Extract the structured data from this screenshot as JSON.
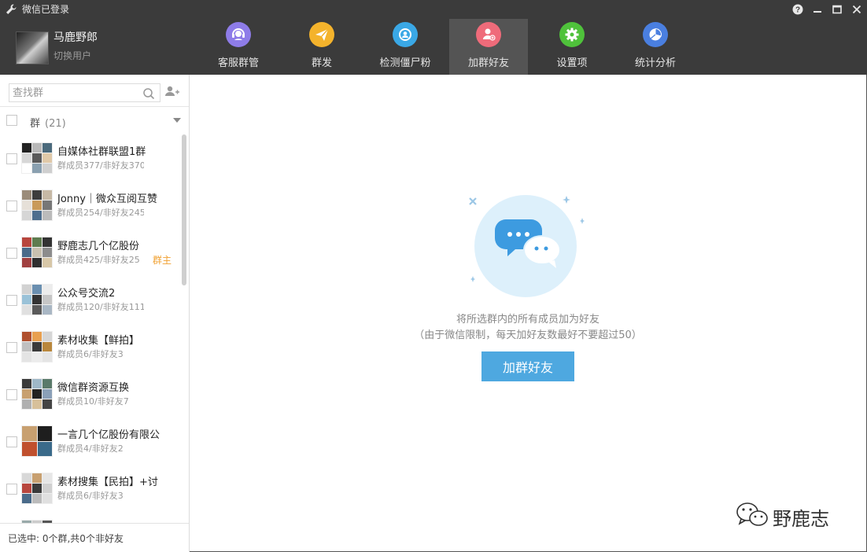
{
  "window": {
    "title": "微信已登录"
  },
  "user": {
    "name": "马鹿野郎",
    "switch_label": "切换用户"
  },
  "nav": [
    {
      "label": "客服群管",
      "icon": "headset-icon",
      "color": "#8e7ce8"
    },
    {
      "label": "群发",
      "icon": "send-icon",
      "color": "#f4b32c"
    },
    {
      "label": "检测僵尸粉",
      "icon": "detect-icon",
      "color": "#3aa8e6"
    },
    {
      "label": "加群好友",
      "icon": "add-friend-icon",
      "color": "#ef6b7a",
      "active": true
    },
    {
      "label": "设置项",
      "icon": "gear-icon",
      "color": "#4fc23b"
    },
    {
      "label": "统计分析",
      "icon": "pie-chart-icon",
      "color": "#4a7fe0"
    }
  ],
  "sidebar": {
    "search_placeholder": "查找群",
    "group_header": {
      "title": "群",
      "count": "(21)"
    },
    "items": [
      {
        "name": "自媒体社群联盟1群",
        "sub": "群成员377/非好友370",
        "badge": ""
      },
      {
        "name": "Jonny｜微众互阅互赞",
        "sub": "群成员254/非好友245",
        "badge": ""
      },
      {
        "name": "野鹿志几个亿股份",
        "sub": "群成员425/非好友25",
        "badge": "群主"
      },
      {
        "name": "公众号交流2",
        "sub": "群成员120/非好友111",
        "badge": ""
      },
      {
        "name": "素材收集【鲜拍】",
        "sub": "群成员6/非好友3",
        "badge": ""
      },
      {
        "name": "微信群资源互换",
        "sub": "群成员10/非好友7",
        "badge": ""
      },
      {
        "name": "一言几个亿股份有限公",
        "sub": "群成员4/非好友2",
        "badge": ""
      },
      {
        "name": "素材搜集【民拍】+讨",
        "sub": "群成员6/非好友3",
        "badge": ""
      },
      {
        "name": "",
        "sub": "",
        "badge": ""
      }
    ],
    "footer": "已选中: 0个群,共0个非好友"
  },
  "main": {
    "hint_line1": "将所选群内的所有成员加为好友",
    "hint_line2": "（由于微信限制，每天加好友数最好不要超过50）",
    "button_label": "加群好友"
  },
  "watermark": {
    "text": "野鹿志"
  },
  "colors": {
    "titlebar": "#3b3b3b",
    "accent": "#4ea8e0",
    "owner_badge": "#f0a030"
  }
}
